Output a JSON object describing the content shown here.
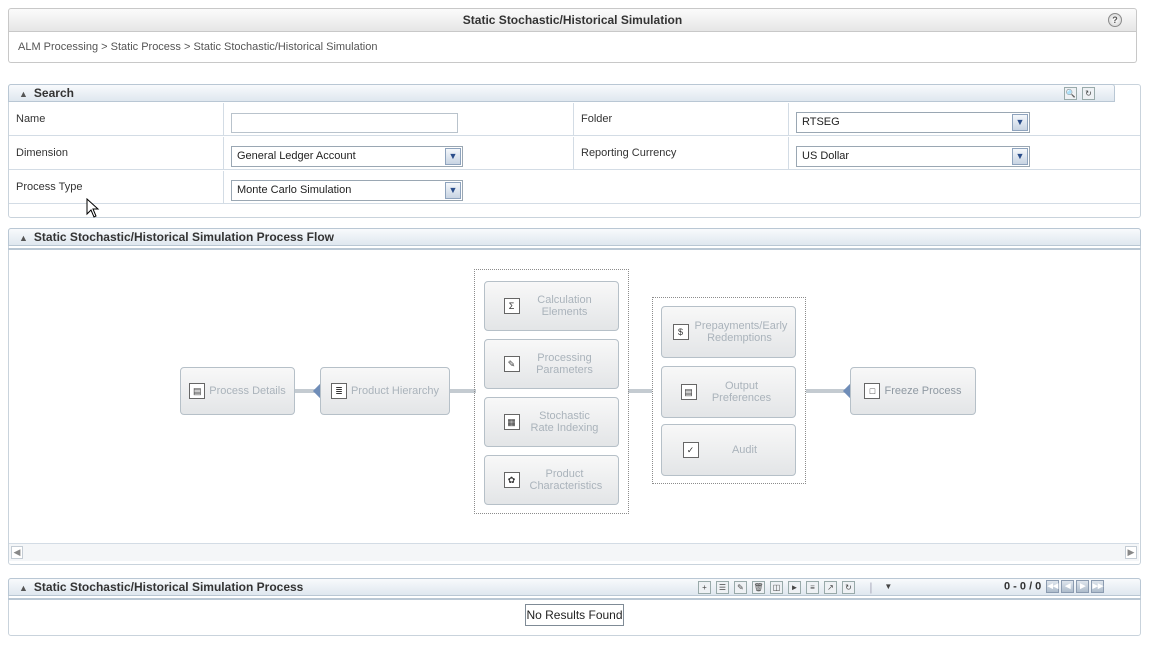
{
  "header": {
    "title": "Static Stochastic/Historical Simulation",
    "help_icon": "help-icon",
    "breadcrumb": "ALM Processing > Static Process > Static Stochastic/Historical Simulation"
  },
  "search": {
    "title": "Search",
    "search_icon": "search-icon",
    "reset_icon": "reset-icon",
    "fields": {
      "name_label": "Name",
      "name_value": "",
      "folder_label": "Folder",
      "folder_value": "RTSEG",
      "dimension_label": "Dimension",
      "dimension_value": "General Ledger Account",
      "currency_label": "Reporting Currency",
      "currency_value": "US Dollar",
      "process_type_label": "Process Type",
      "process_type_value": "Monte Carlo Simulation"
    }
  },
  "flow": {
    "title": "Static Stochastic/Historical Simulation Process Flow",
    "process_details": "Process Details",
    "product_hierarchy": "Product Hierarchy",
    "calc_elements": "Calculation Elements",
    "processing_params": "Processing Parameters",
    "stochastic_rate": "Stochastic Rate Indexing",
    "product_chars": "Product Characteristics",
    "prepayments": "Prepayments/Early Redemptions",
    "output_prefs": "Output Preferences",
    "audit": "Audit",
    "freeze": "Freeze Process"
  },
  "results": {
    "title": "Static Stochastic/Historical Simulation Process",
    "pager_text": "0 - 0 / 0",
    "empty_text": "No Results Found"
  },
  "colors": {
    "header_border": "#b9c7d4",
    "flow_disabled_text": "#aab3bb",
    "connector_accent": "#6f8db8"
  }
}
